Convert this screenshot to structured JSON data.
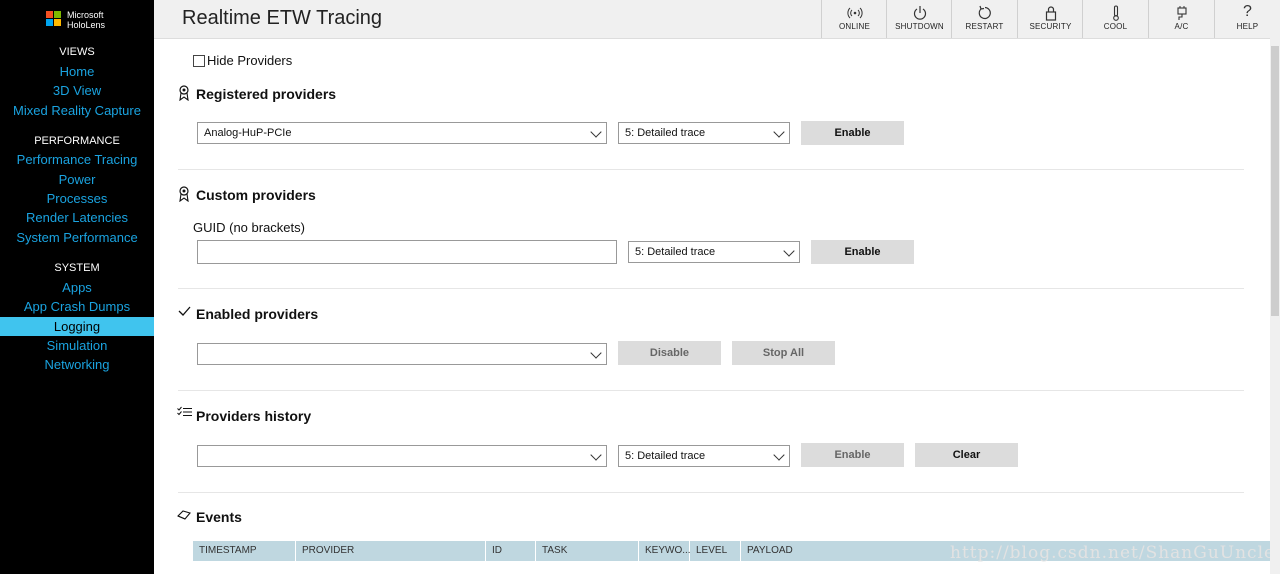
{
  "sidebar": {
    "logo_line1": "Microsoft",
    "logo_line2": "HoloLens",
    "logo_colors": [
      "#f25022",
      "#7fba00",
      "#00a4ef",
      "#ffb900"
    ],
    "sections": [
      {
        "title": "VIEWS",
        "items": [
          "Home",
          "3D View",
          "Mixed Reality Capture"
        ]
      },
      {
        "title": "PERFORMANCE",
        "items": [
          "Performance Tracing",
          "Power",
          "Processes",
          "Render Latencies",
          "System Performance"
        ]
      },
      {
        "title": "SYSTEM",
        "items": [
          "Apps",
          "App Crash Dumps",
          "Logging",
          "Simulation",
          "Networking"
        ]
      }
    ],
    "active_item": "Logging"
  },
  "header": {
    "title": "Realtime ETW Tracing",
    "toolbar": [
      {
        "label": "ONLINE",
        "icon": "wireless-icon"
      },
      {
        "label": "SHUTDOWN",
        "icon": "power-icon"
      },
      {
        "label": "RESTART",
        "icon": "restart-icon"
      },
      {
        "label": "SECURITY",
        "icon": "lock-icon"
      },
      {
        "label": "COOL",
        "icon": "thermometer-icon"
      },
      {
        "label": "A/C",
        "icon": "plug-icon"
      },
      {
        "label": "HELP",
        "icon": "question-icon"
      }
    ]
  },
  "main": {
    "hide_providers_label": "Hide Providers",
    "registered": {
      "title": "Registered providers",
      "provider_value": "Analog-HuP-PCIe",
      "level_value": "5: Detailed trace",
      "enable_label": "Enable"
    },
    "custom": {
      "title": "Custom providers",
      "guid_label": "GUID (no brackets)",
      "guid_value": "",
      "level_value": "5: Detailed trace",
      "enable_label": "Enable"
    },
    "enabled": {
      "title": "Enabled providers",
      "provider_value": "",
      "disable_label": "Disable",
      "stop_all_label": "Stop All"
    },
    "history": {
      "title": "Providers history",
      "provider_value": "",
      "level_value": "5: Detailed trace",
      "enable_label": "Enable",
      "clear_label": "Clear"
    },
    "events": {
      "title": "Events",
      "columns": [
        "TIMESTAMP",
        "PROVIDER",
        "ID",
        "TASK",
        "KEYWO...",
        "LEVEL",
        "PAYLOAD"
      ]
    }
  },
  "watermark": "http://blog.csdn.net/ShanGuUncle",
  "colors": {
    "sidebar_bg": "#000000",
    "nav_link": "#1aa3e0",
    "nav_active": "#40c4ee",
    "table_header": "#bfd7e0"
  }
}
